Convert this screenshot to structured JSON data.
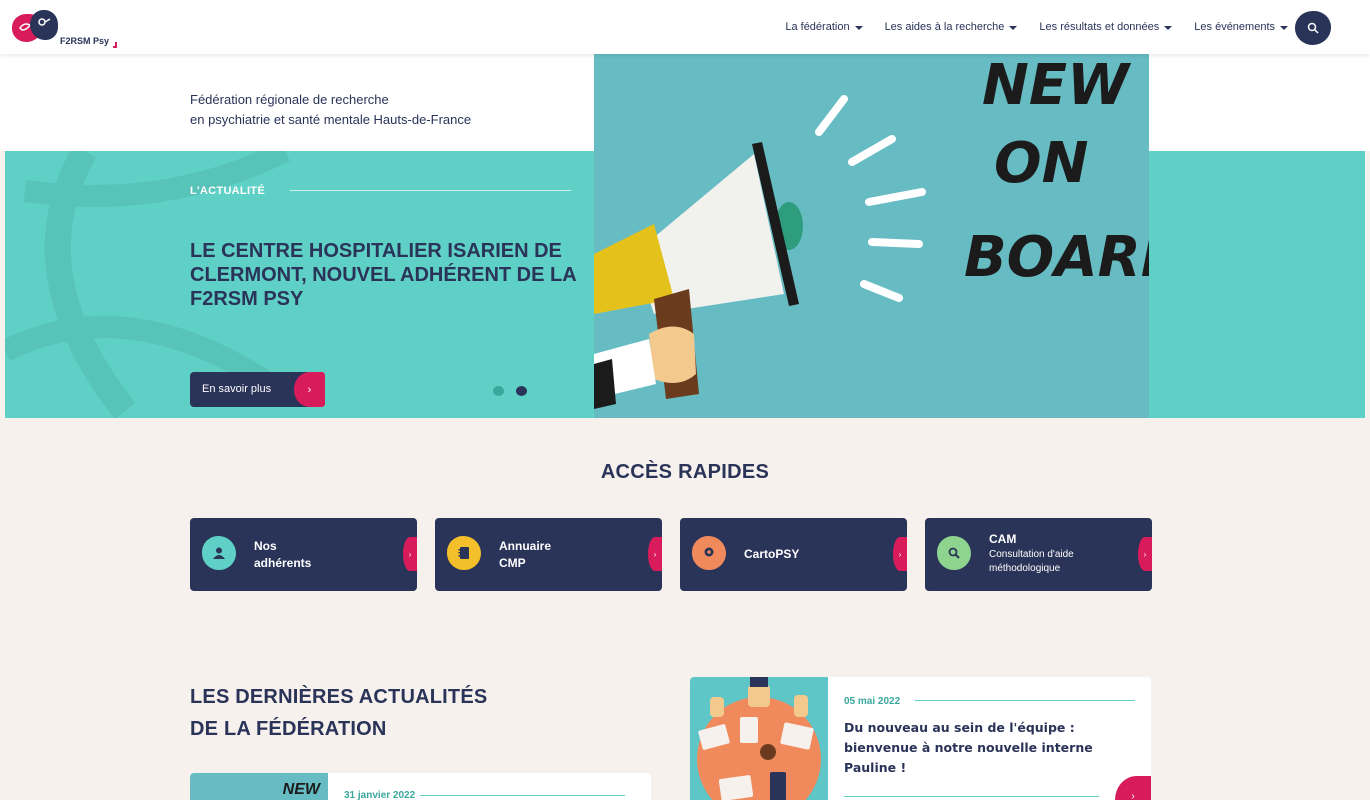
{
  "header": {
    "logo_text": "F2RSM Psy",
    "nav": [
      {
        "label": "La fédération"
      },
      {
        "label": "Les aides à la recherche"
      },
      {
        "label": "Les résultats et données"
      },
      {
        "label": "Les événements"
      }
    ]
  },
  "hero": {
    "subtitle_line1": "Fédération régionale de recherche",
    "subtitle_line2": "en psychiatrie et santé mentale Hauts-de-France",
    "kicker": "L'ACTUALITÉ",
    "title": "LE CENTRE HOSPITALIER ISARIEN DE CLERMONT, NOUVEL ADHÉRENT DE LA F2RSM PSY",
    "button_label": "En savoir plus",
    "arrow": "›",
    "image_text": [
      "NEW",
      "ON",
      "BOARD"
    ],
    "slides": 2,
    "active_slide": 2
  },
  "quick_access": {
    "title": "ACCÈS RAPIDES",
    "cards": [
      {
        "title": "Nos adhérents",
        "subtitle": "",
        "icon": "people-icon",
        "color": "#5fd0c5"
      },
      {
        "title": "Annuaire CMP",
        "subtitle": "",
        "icon": "notebook-icon",
        "color": "#f3bf2a"
      },
      {
        "title": "CartoPSY",
        "subtitle": "",
        "icon": "map-pin-icon",
        "color": "#f08a5d"
      },
      {
        "title": "CAM",
        "subtitle": "Consultation d'aide méthodologique",
        "icon": "magnifier-icon",
        "color": "#8ed48e"
      }
    ]
  },
  "news": {
    "title_line1": "LES DERNIÈRES ACTUALITÉS",
    "title_line2": "DE LA FÉDÉRATION",
    "cards": [
      {
        "date": "31 janvier 2022",
        "thumb_text": "NEW"
      },
      {
        "date": "05 mai 2022",
        "headline": "Du nouveau au sein de l'équipe : bienvenue à notre nouvelle interne Pauline !"
      }
    ]
  },
  "colors": {
    "navy": "#2a3358",
    "teal": "#5fd0c5",
    "pink": "#d81b5b",
    "cream": "#f6f1ec"
  }
}
